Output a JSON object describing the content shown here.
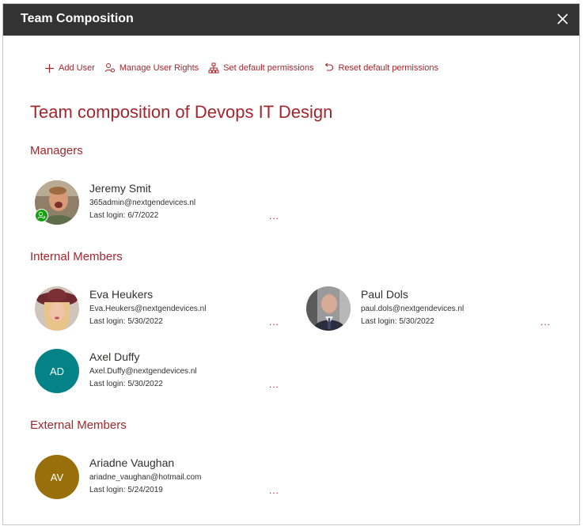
{
  "dialog": {
    "title": "Team Composition"
  },
  "toolbar": {
    "add_user": "Add User",
    "manage_rights": "Manage User Rights",
    "set_default": "Set default permissions",
    "reset_default": "Reset default permissions"
  },
  "heading": "Team composition of Devops IT Design",
  "sections": {
    "managers": {
      "title": "Managers",
      "people": [
        {
          "name": "Jeremy Smit",
          "email": "365admin@nextgendevices.nl",
          "last_login": "Last login: 6/7/2022",
          "more": "..."
        }
      ]
    },
    "internal": {
      "title": "Internal Members",
      "people": [
        {
          "name": "Eva Heukers",
          "email": "Eva.Heukers@nextgendevices.nl",
          "last_login": "Last login: 5/30/2022",
          "more": "..."
        },
        {
          "name": "Paul Dols",
          "email": "paul.dols@nextgendevices.nl",
          "last_login": "Last login: 5/30/2022",
          "more": "..."
        },
        {
          "name": "Axel Duffy",
          "email": "Axel.Duffy@nextgendevices.nl",
          "last_login": "Last login: 5/30/2022",
          "more": "...",
          "initials": "AD"
        }
      ]
    },
    "external": {
      "title": "External Members",
      "people": [
        {
          "name": "Ariadne Vaughan",
          "email": "ariadne_vaughan@hotmail.com",
          "last_login": "Last login: 5/24/2019",
          "more": "...",
          "initials": "AV"
        }
      ]
    }
  },
  "colors": {
    "accent": "#a4262c",
    "titlebar": "#333333",
    "avatar_ad": "#038387",
    "avatar_av": "#986f0b",
    "manager_badge": "#13a10e"
  },
  "icons": [
    "close-icon",
    "add-icon",
    "manage-rights-icon",
    "hierarchy-icon",
    "undo-icon",
    "manager-badge-icon"
  ]
}
